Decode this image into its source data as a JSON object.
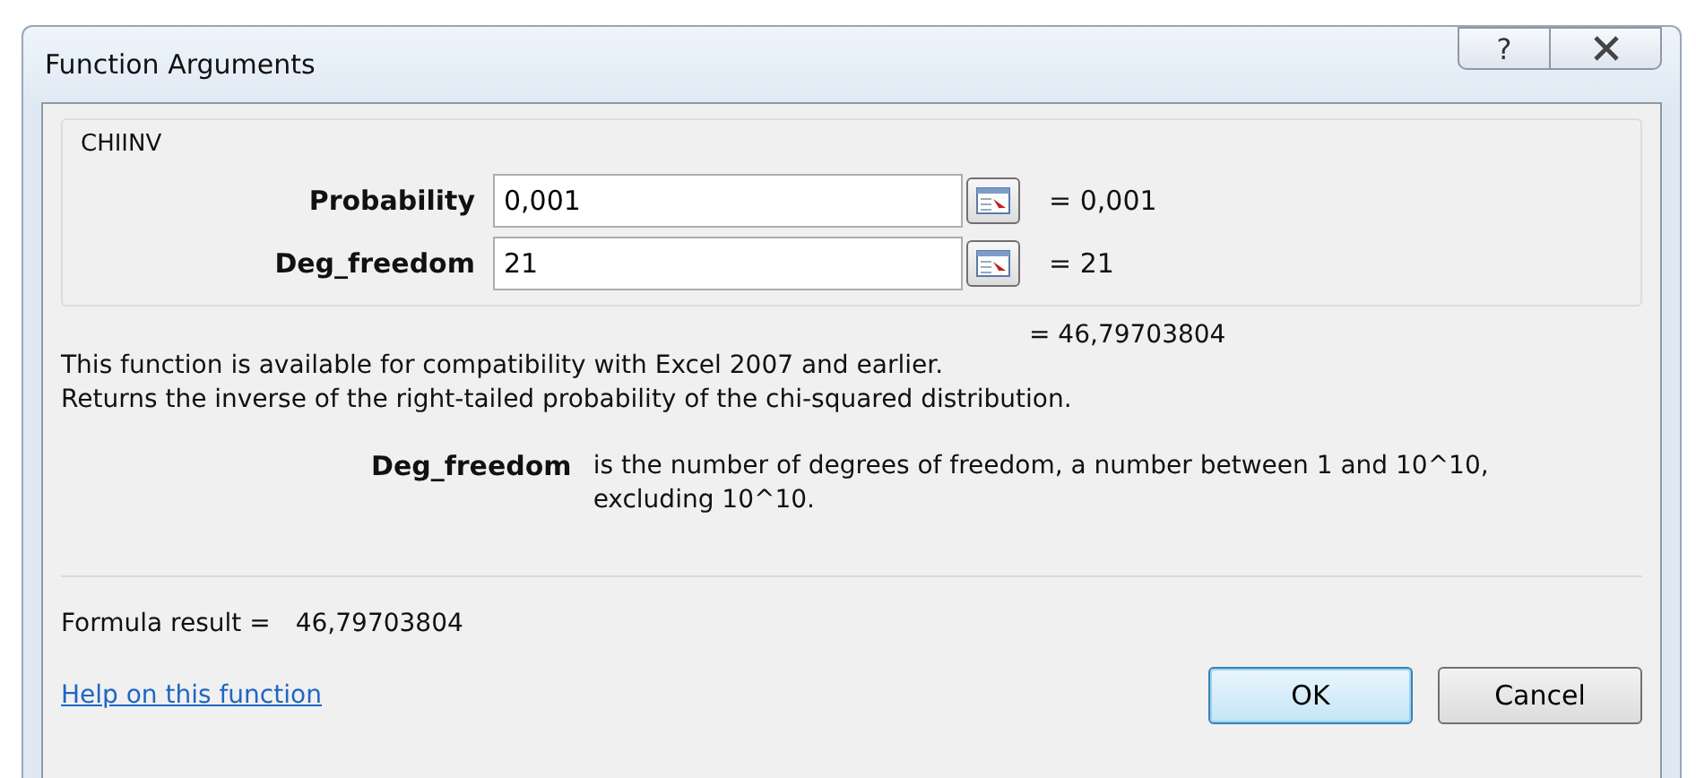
{
  "window": {
    "title": "Function Arguments",
    "help_button": "?"
  },
  "function_name": "CHIINV",
  "arguments": [
    {
      "label": "Probability",
      "value": "0,001",
      "result": "= 0,001"
    },
    {
      "label": "Deg_freedom",
      "value": "21",
      "result": "= 21"
    }
  ],
  "function_result": "= 46,79703804",
  "description": [
    "This function is available for compatibility with Excel 2007 and earlier.",
    "Returns the inverse of the right-tailed probability of the chi-squared distribution."
  ],
  "argument_help": {
    "name": "Deg_freedom",
    "text": "is the number of degrees of freedom, a number between 1 and 10^10, excluding 10^10."
  },
  "formula_result": {
    "label": "Formula result =",
    "value": "46,79703804"
  },
  "help_link": "Help on this function",
  "buttons": [
    {
      "label": "OK",
      "default": true
    },
    {
      "label": "Cancel",
      "default": false
    }
  ]
}
